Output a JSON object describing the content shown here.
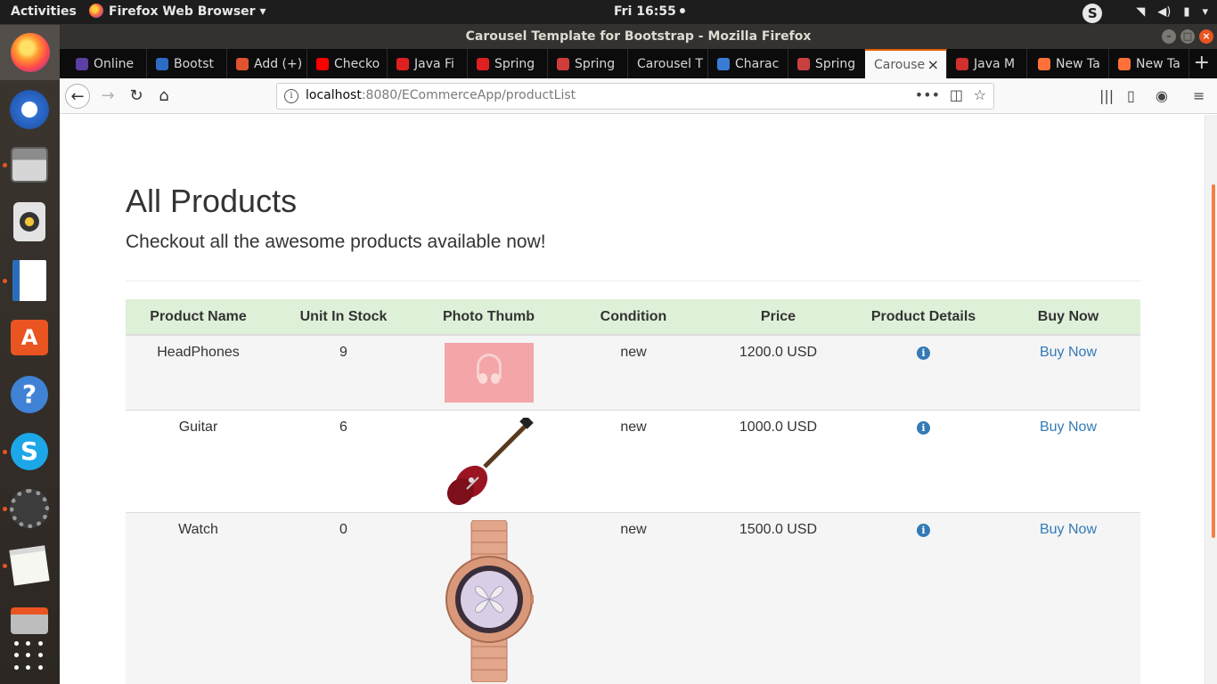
{
  "topbar": {
    "activities": "Activities",
    "app_menu": "Firefox Web Browser",
    "clock": "Fri 16:55"
  },
  "window": {
    "title": "Carousel Template for Bootstrap - Mozilla Firefox"
  },
  "tabs": [
    {
      "label": "Online",
      "fav_color": "#5b3fa3"
    },
    {
      "label": "Bootst",
      "fav_color": "#2b6cc4"
    },
    {
      "label": "Add (+)",
      "fav_color": "#e0532f"
    },
    {
      "label": "Checko",
      "fav_color": "#ff0000"
    },
    {
      "label": "Java Fi",
      "fav_color": "#e02020"
    },
    {
      "label": "Spring",
      "fav_color": "#e02020"
    },
    {
      "label": "Spring",
      "fav_color": "#d03b3b"
    },
    {
      "label": "Carousel T",
      "fav_color": ""
    },
    {
      "label": "Charac",
      "fav_color": "#3a7bd5"
    },
    {
      "label": "Spring",
      "fav_color": "#c94040"
    },
    {
      "label": "Carouse",
      "fav_color": "",
      "active": true
    },
    {
      "label": "Java M",
      "fav_color": "#d0302e"
    },
    {
      "label": "New Ta",
      "fav_color": "#ff7139"
    },
    {
      "label": "New Ta",
      "fav_color": "#ff7139"
    }
  ],
  "url": {
    "host": "localhost",
    "rest": ":8080/ECommerceApp/productList"
  },
  "page": {
    "title": "All Products",
    "lead": "Checkout all the awesome products available now!"
  },
  "table": {
    "headers": [
      "Product Name",
      "Unit In Stock",
      "Photo Thumb",
      "Condition",
      "Price",
      "Product Details",
      "Buy Now"
    ],
    "rows": [
      {
        "name": "HeadPhones",
        "stock": "9",
        "thumb": "headphones-photo",
        "condition": "new",
        "price": "1200.0 USD",
        "buy": "Buy Now"
      },
      {
        "name": "Guitar",
        "stock": "6",
        "thumb": "guitar-photo",
        "condition": "new",
        "price": "1000.0 USD",
        "buy": "Buy Now"
      },
      {
        "name": "Watch",
        "stock": "0",
        "thumb": "watch-photo",
        "condition": "new",
        "price": "1500.0 USD",
        "buy": "Buy Now"
      }
    ]
  },
  "colors": {
    "accent": "#e95420",
    "link": "#337ab7",
    "table_header_bg": "#dff0d8"
  }
}
